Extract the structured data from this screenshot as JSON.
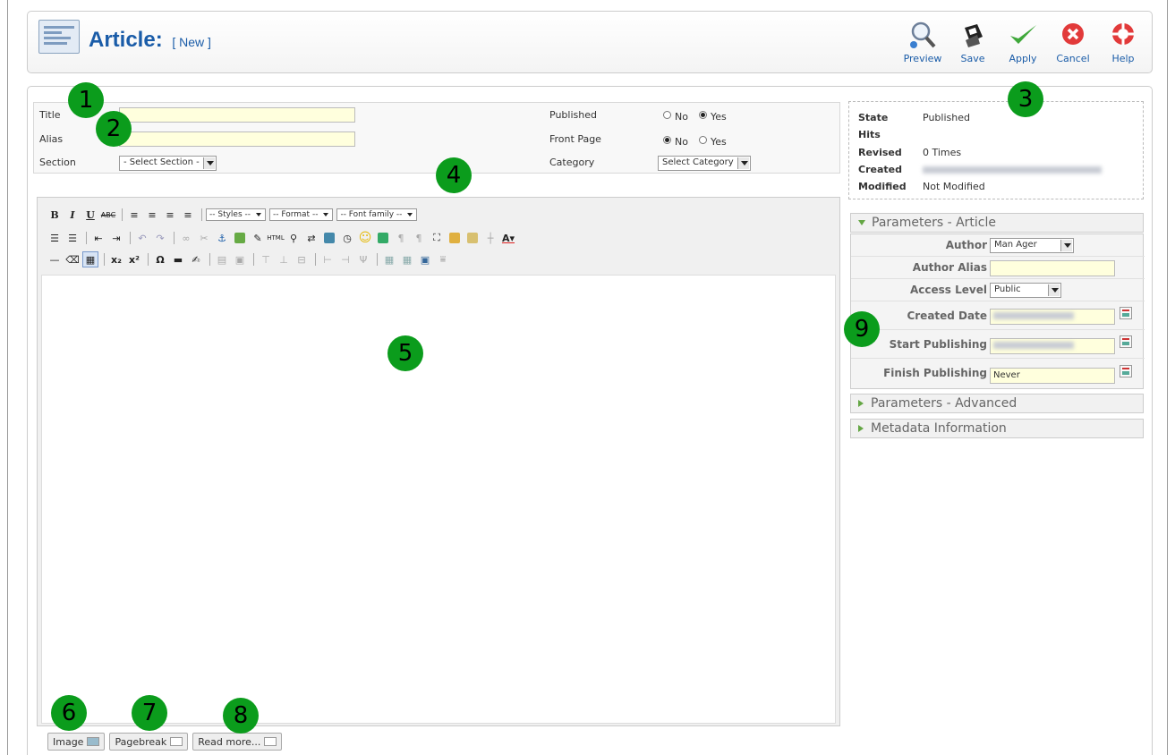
{
  "header": {
    "title": "Article:",
    "subtitle": "[ New ]",
    "toolbar": [
      {
        "label": "Preview",
        "icon": "magnifier-icon"
      },
      {
        "label": "Save",
        "icon": "floppy-icon"
      },
      {
        "label": "Apply",
        "icon": "checkmark-icon"
      },
      {
        "label": "Cancel",
        "icon": "cancel-icon"
      },
      {
        "label": "Help",
        "icon": "lifebuoy-icon"
      }
    ]
  },
  "details": {
    "title_label": "Title",
    "title_value": "",
    "alias_label": "Alias",
    "alias_value": "",
    "section_label": "Section",
    "section_value": "- Select Section -",
    "published_label": "Published",
    "published_no": "No",
    "published_yes": "Yes",
    "published_selected": "Yes",
    "frontpage_label": "Front Page",
    "frontpage_no": "No",
    "frontpage_yes": "Yes",
    "frontpage_selected": "No",
    "category_label": "Category",
    "category_value": "Select Category"
  },
  "editor": {
    "styles_value": "-- Styles --",
    "format_value": "-- Format --",
    "fontfamily_value": "-- Font family --",
    "buttons": {
      "image": "Image",
      "pagebreak": "Pagebreak",
      "readmore": "Read more..."
    }
  },
  "meta": {
    "state_label": "State",
    "state_value": "Published",
    "hits_label": "Hits",
    "revised_label": "Revised",
    "revised_value": "0 Times",
    "created_label": "Created",
    "modified_label": "Modified",
    "modified_value": "Not Modified"
  },
  "params": {
    "article_header": "Parameters - Article",
    "author_label": "Author",
    "author_value": "Man Ager",
    "author_alias_label": "Author Alias",
    "access_level_label": "Access Level",
    "access_level_value": "Public",
    "created_date_label": "Created Date",
    "start_publishing_label": "Start Publishing",
    "finish_publishing_label": "Finish Publishing",
    "finish_publishing_value": "Never",
    "advanced_header": "Parameters - Advanced",
    "metadata_header": "Metadata Information"
  },
  "badges": [
    "1",
    "2",
    "3",
    "4",
    "5",
    "6",
    "7",
    "8",
    "9"
  ],
  "colors": {
    "accent": "#1a5ca8",
    "badge": "#0b9c1c",
    "input_bg": "#ffffdd"
  }
}
